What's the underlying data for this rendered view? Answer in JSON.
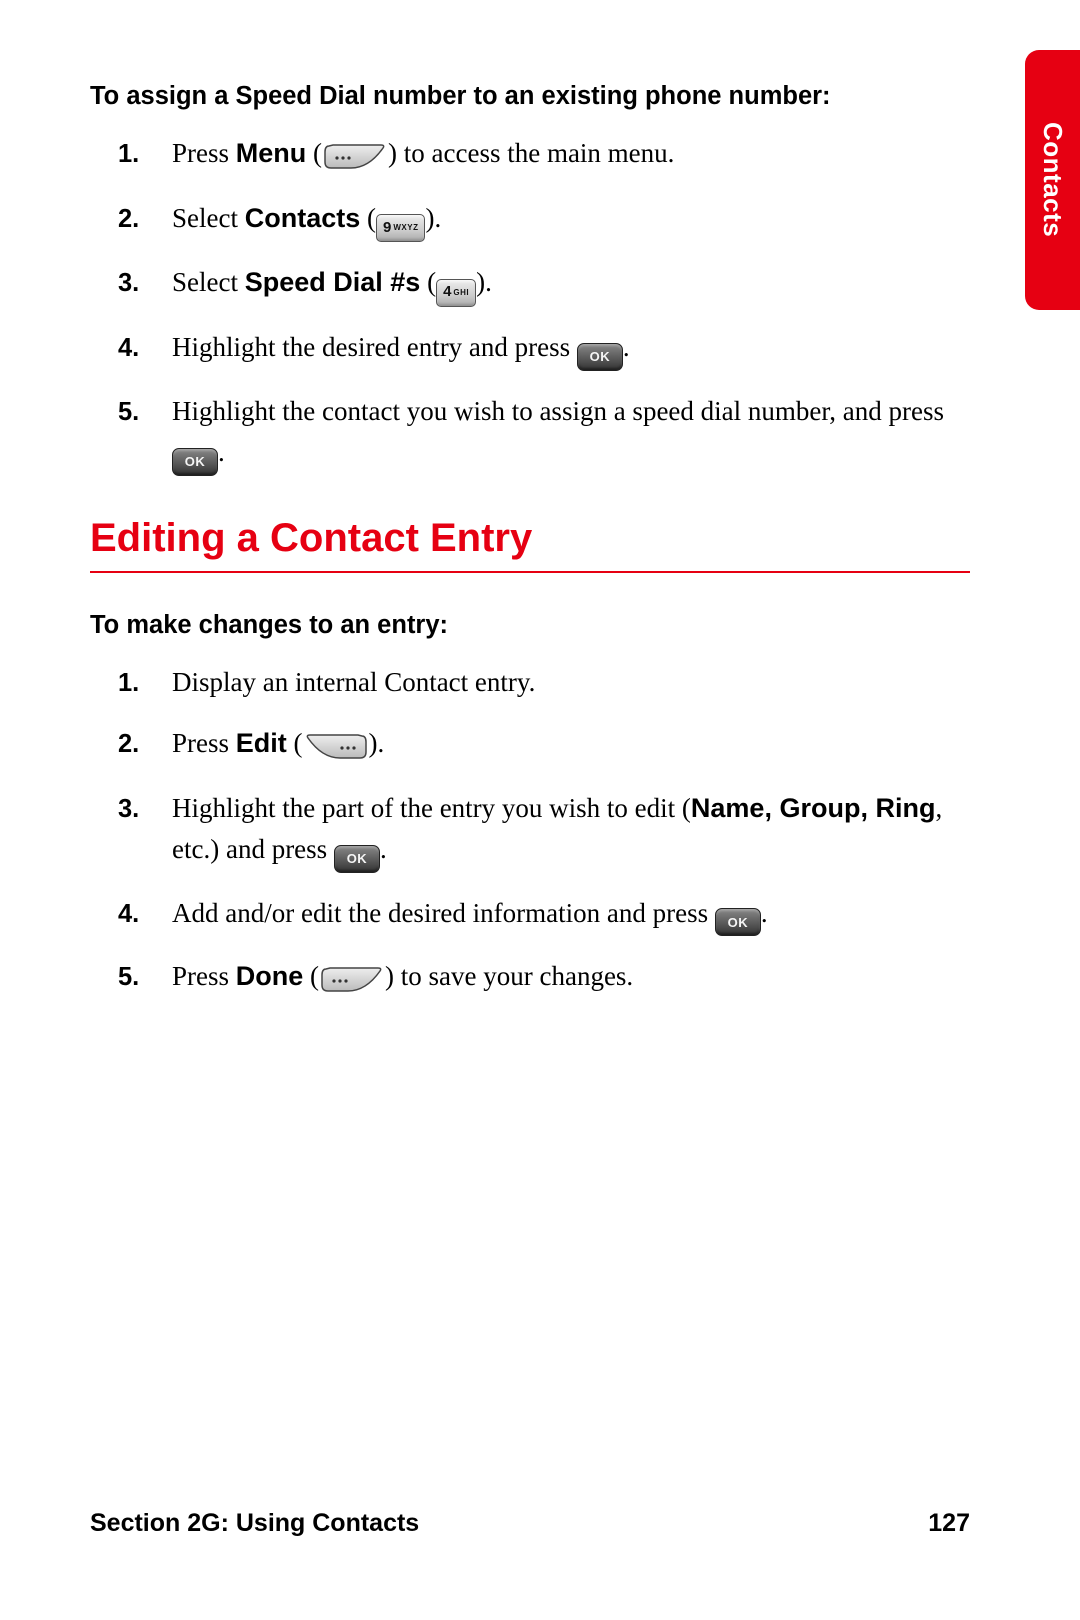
{
  "sideTab": "Contacts",
  "section1": {
    "subhead": "To assign a Speed Dial number to an existing phone number:",
    "steps": [
      {
        "num": "1.",
        "pre": "Press ",
        "bold": "Menu",
        "post": " (",
        "icon": "softkey-left",
        "tail": ") to access the main menu."
      },
      {
        "num": "2.",
        "pre": "Select ",
        "bold": "Contacts",
        "post": " (",
        "icon": "key-9",
        "tail": ")."
      },
      {
        "num": "3.",
        "pre": "Select ",
        "bold": "Speed Dial #s",
        "post": " (",
        "icon": "key-4",
        "tail": ")."
      },
      {
        "num": "4.",
        "pre": "Highlight the desired entry and press ",
        "bold": "",
        "post": "",
        "icon": "ok",
        "tail": "."
      },
      {
        "num": "5.",
        "pre": "Highlight the contact you wish to assign a speed dial number, and press ",
        "bold": "",
        "post": "",
        "icon": "ok",
        "tail": "."
      }
    ]
  },
  "heading": "Editing a Contact Entry",
  "section2": {
    "subhead": "To make changes to an entry:",
    "steps": [
      {
        "num": "1.",
        "text": "Display an internal Contact entry."
      },
      {
        "num": "2.",
        "pre": "Press ",
        "bold": "Edit",
        "post": " (",
        "icon": "softkey-right",
        "tail": ")."
      },
      {
        "num": "3.",
        "pre": "Highlight the part of the entry you wish to edit (",
        "boldList": "Name, Group, Ring",
        "post2": ", etc.) and press ",
        "icon": "ok",
        "tail": "."
      },
      {
        "num": "4.",
        "pre": "Add and/or edit the desired information and press ",
        "icon": "ok",
        "tail": "."
      },
      {
        "num": "5.",
        "pre": "Press ",
        "bold": "Done",
        "post": " (",
        "icon": "softkey-left",
        "tail": ") to save your changes."
      }
    ]
  },
  "footer": {
    "left": "Section 2G: Using Contacts",
    "right": "127"
  },
  "keys": {
    "key9": {
      "digit": "9",
      "letters": "WXYZ"
    },
    "key4": {
      "digit": "4",
      "letters": "GHI"
    },
    "ok": "OK"
  },
  "colors": {
    "accent": "#e60012"
  }
}
